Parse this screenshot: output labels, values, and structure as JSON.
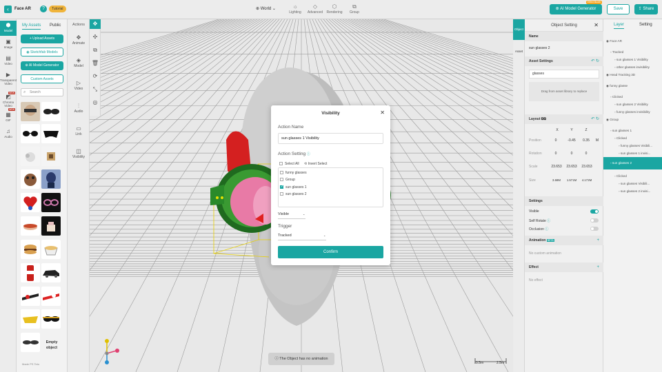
{
  "header": {
    "back_icon": "chevron-left-icon",
    "project_title": "Face AR",
    "help": "?",
    "tutorial": "Tutorial",
    "world": "World",
    "tools": [
      {
        "label": "Lighting",
        "icon": "sun-icon"
      },
      {
        "label": "Advanced",
        "icon": "cube-icon"
      },
      {
        "label": "Rendering",
        "icon": "render-icon"
      },
      {
        "label": "Group",
        "icon": "group-icon"
      }
    ],
    "ai_button": "AI Model Generator",
    "ai_badge": "Effect Booth",
    "save": "Save",
    "share": "Share"
  },
  "rail": [
    {
      "label": "Model"
    },
    {
      "label": "Image"
    },
    {
      "label": "Video"
    },
    {
      "label": "Transparent Video"
    },
    {
      "label": "Chroma Video"
    },
    {
      "label": "GIF"
    },
    {
      "label": "Audio"
    }
  ],
  "rail_new": "NEW",
  "assets": {
    "tab_my": "My Assets",
    "tab_public": "Public",
    "upload": "+ Upload Assets",
    "sketchfab": "Sketchfab Models",
    "ai": "AI Model Generator",
    "custom": "Custom Assets",
    "search_placeholder": "Search",
    "empty_object": "Empty object",
    "bottom_text": "Made PS Teto"
  },
  "actions": {
    "title": "Actions",
    "items": [
      "Animate",
      "Model",
      "Video",
      "Audio",
      "Link",
      "Visibility"
    ]
  },
  "viewport": {
    "toast": "The Object has no animation",
    "scale_small": "0.5m",
    "scale_large": "2.5m"
  },
  "sidetabs": {
    "object": "Object",
    "asset": "Asset"
  },
  "props": {
    "title": "Object Setting",
    "name_label": "Name",
    "name_value": "sun glasses 2",
    "asset_settings": "Asset Settings",
    "asset_value": "glasses",
    "drag_hint": "Drag from asset library to replace",
    "layout": "Layout",
    "axes": [
      "X",
      "Y",
      "Z"
    ],
    "position_label": "Position",
    "position": [
      "0",
      "-0.45",
      "0.35"
    ],
    "position_unit": "M",
    "rotation_label": "Rotation",
    "rotation": [
      "0",
      "0",
      "0"
    ],
    "scale_label": "Scale",
    "scale": [
      "23.653",
      "23.653",
      "23.653"
    ],
    "size_label": "Size",
    "size": [
      "3.68M",
      "1.571M",
      "4.172M"
    ],
    "settings": "Settings",
    "visible": "Visible",
    "self_rotate": "Self Rotate",
    "occlusion": "Occlusion",
    "animation": "Animation",
    "animation_badge": "BETA",
    "no_animation": "No custom animation",
    "effect": "Effect",
    "no_effect": "No effect"
  },
  "layers": {
    "tab_layer": "Layer",
    "tab_setting": "Setting",
    "items": [
      {
        "label": "Face AR",
        "indent": 0
      },
      {
        "label": "Tracked",
        "indent": 1
      },
      {
        "label": "sun glasses 1 Visibility",
        "indent": 2
      },
      {
        "label": "other glasses invisibility",
        "indent": 2
      },
      {
        "label": "Head Tracking 3D",
        "indent": 0
      },
      {
        "label": "funny glasse",
        "indent": 0
      },
      {
        "label": "Clicked",
        "indent": 1
      },
      {
        "label": "sun glasses 2 Visibility",
        "indent": 2
      },
      {
        "label": "funny glasses invisibility",
        "indent": 2
      },
      {
        "label": "Group",
        "indent": 0
      },
      {
        "label": "sun glasses 1",
        "indent": 1
      },
      {
        "label": "Clicked",
        "indent": 2
      },
      {
        "label": "funny glasses Visibili...",
        "indent": 3
      },
      {
        "label": "sun glasses 1 invisi...",
        "indent": 3
      },
      {
        "label": "sun glasses 2",
        "indent": 1,
        "selected": true
      },
      {
        "label": "Clicked",
        "indent": 2
      },
      {
        "label": "sun glasses Visibili...",
        "indent": 3
      },
      {
        "label": "sun glasses 2 invisi...",
        "indent": 3
      }
    ]
  },
  "modal": {
    "title": "Visibility",
    "action_name_label": "Action Name",
    "action_name_value": "sun glasses 1 Visibility",
    "action_setting_label": "Action Setting",
    "select_all": "Select All",
    "invert_select": "Invert Select",
    "options": [
      {
        "label": "funny glasses",
        "checked": false
      },
      {
        "label": "Group",
        "checked": false
      },
      {
        "label": "sun glasses 1",
        "checked": true
      },
      {
        "label": "sun glasses 2",
        "checked": false
      }
    ],
    "visible_value": "Visible",
    "trigger_label": "Trigger",
    "trigger_value": "Tracked",
    "confirm": "Confirm"
  },
  "colors": {
    "accent": "#1aa6a2",
    "modal_bg": "#ffffff",
    "frame": "#2d8a2d",
    "lens": "#e4609a"
  }
}
